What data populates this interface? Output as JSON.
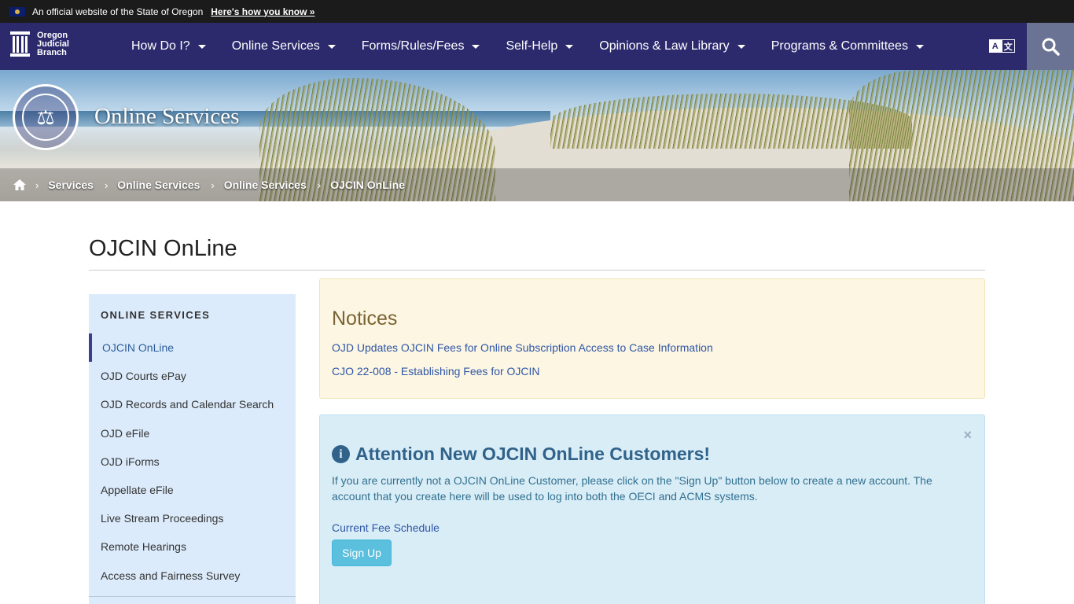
{
  "official_banner": {
    "text": "An official website of the State of Oregon",
    "link": "Here's how you know »"
  },
  "logo": {
    "line1": "Oregon",
    "line2": "Judicial",
    "line3": "Branch"
  },
  "nav": {
    "items": [
      {
        "label": "How Do I?"
      },
      {
        "label": "Online Services"
      },
      {
        "label": "Forms/Rules/Fees"
      },
      {
        "label": "Self-Help"
      },
      {
        "label": "Opinions & Law Library"
      },
      {
        "label": "Programs & Committees"
      }
    ],
    "translate": {
      "a": "A",
      "b": "文"
    }
  },
  "hero": {
    "title": "Online Services",
    "breadcrumbs": [
      "Services",
      "Online Services",
      "Online Services",
      "OJCIN OnLine"
    ]
  },
  "page": {
    "title": "OJCIN OnLine"
  },
  "sidebar": {
    "heading": "ONLINE SERVICES",
    "items": [
      {
        "label": "OJCIN OnLine"
      },
      {
        "label": "OJD Courts ePay"
      },
      {
        "label": "OJD Records and Calendar Search"
      },
      {
        "label": "OJD eFile"
      },
      {
        "label": "OJD iForms"
      },
      {
        "label": "Appellate eFile"
      },
      {
        "label": "Live Stream Proceedings"
      },
      {
        "label": "Remote Hearings"
      },
      {
        "label": "Access and Fairness Survey"
      }
    ]
  },
  "notices": {
    "title": "Notices",
    "links": [
      "OJD Updates OJCIN Fees for Online Subscription Access to Case Information",
      "CJO 22-008 - Establishing Fees for OJCIN"
    ]
  },
  "alert": {
    "title": "Attention New OJCIN OnLine Customers!",
    "text": "If you are currently not a OJCIN OnLine Customer, please click on the \"Sign Up\" button below to create a new account. The account that you create here will be used to log into both the OECI and ACMS systems.",
    "fee_link": "Current Fee Schedule",
    "button": "Sign Up",
    "close": "×"
  },
  "colors": {
    "nav_bg": "#2c2a6d",
    "search_bg": "#6b7394",
    "sidebar_bg": "#dcebfb",
    "notices_bg": "#fcf6e3",
    "alert_bg": "#d9edf7",
    "button_bg": "#5bc0de",
    "link": "#2f56a6"
  }
}
